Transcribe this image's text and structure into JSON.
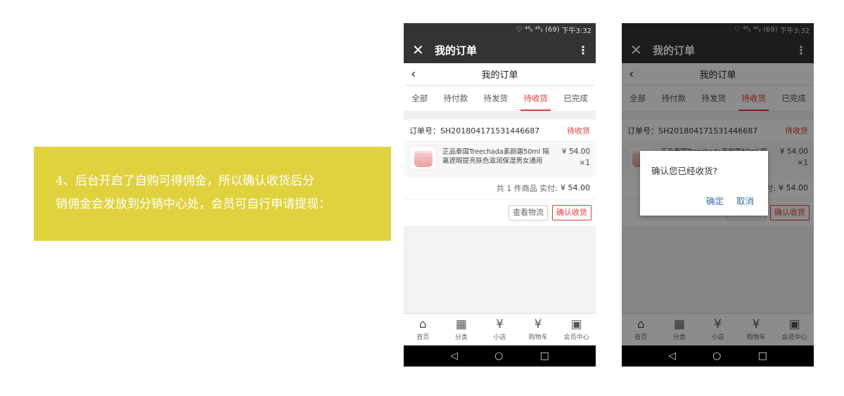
{
  "note": {
    "line1": "4、后台开启了自购可得佣金，所以确认收货后分",
    "line2": "销佣金会发放到分销中心处，会员可自行申请提现："
  },
  "status_bar": {
    "icons": "♡ ⁴⁶ₗₗ ⁴⁶ₗₗ (69)",
    "time": "下午3:32"
  },
  "app_bar": {
    "title": "我的订单",
    "close_icon": "close-icon",
    "more_icon": "more-vertical-icon"
  },
  "page": {
    "title": "我的订单",
    "back_icon": "chevron-left-icon"
  },
  "tabs": [
    {
      "label": "全部"
    },
    {
      "label": "待付款"
    },
    {
      "label": "待发货"
    },
    {
      "label": "待收货",
      "active": true
    },
    {
      "label": "已完成"
    }
  ],
  "order": {
    "number_label": "订单号：SH201804171531446687",
    "status": "待收货",
    "product_name": "正品泰国Treechada素颜霜50ml 隔离遮瑕提亮肤色滋润保湿男女通用",
    "price": "¥ 54.00",
    "quantity": "×1",
    "total_label": "共 1 件商品 实付:",
    "total_amount": "¥ 54.00",
    "logistics_button": "查看物流",
    "confirm_button": "确认收货"
  },
  "bottom_nav": [
    {
      "label": "首页",
      "icon": "store-icon",
      "glyph": "⌂"
    },
    {
      "label": "分类",
      "icon": "grid-icon",
      "glyph": "▦"
    },
    {
      "label": "小店",
      "icon": "shop-ticket-icon",
      "glyph": "¥"
    },
    {
      "label": "购物车",
      "icon": "cart-yen-icon",
      "glyph": "¥"
    },
    {
      "label": "会员中心",
      "icon": "qr-code-icon",
      "glyph": "▣"
    }
  ],
  "system_nav": {
    "back": "◁",
    "home": "○",
    "recent": "□"
  },
  "dialog": {
    "message": "确认您已经收货?",
    "ok": "确定",
    "cancel": "取消"
  },
  "colors": {
    "accent": "#e23a3a",
    "note_bg": "#e0d23f",
    "bar": "#333333",
    "dialog_button": "#3a6ea8"
  }
}
